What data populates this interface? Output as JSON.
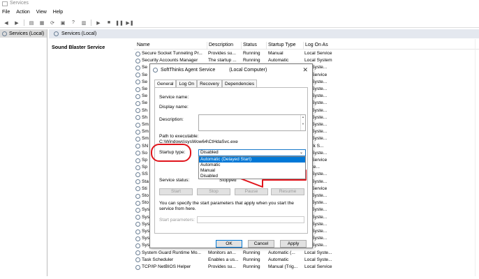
{
  "window": {
    "title": "Services"
  },
  "menu": [
    "File",
    "Action",
    "View",
    "Help"
  ],
  "sidebar": {
    "item": "Services (Local)"
  },
  "panel": {
    "tab": "Services (Local)",
    "selected_service": "Sound Blaster Service"
  },
  "table": {
    "headers": {
      "name": "Name",
      "description": "Description",
      "status": "Status",
      "startup": "Startup Type",
      "logon": "Log On As"
    },
    "rows": [
      {
        "name": "Secure Socket Tunneling Pr...",
        "description": "Provides su...",
        "status": "Running",
        "startup": "Manual",
        "logon": "Local Service"
      },
      {
        "name": "Security Accounts Manager",
        "description": "The startup ...",
        "status": "Running",
        "startup": "Automatic",
        "logon": "Local System"
      },
      {
        "name": "Se",
        "description": "",
        "status": "",
        "startup": "",
        "logon": "cal Syste..."
      },
      {
        "name": "Se",
        "description": "",
        "status": "",
        "startup": "",
        "logon": "cal Service"
      },
      {
        "name": "Se",
        "description": "",
        "status": "",
        "startup": "",
        "logon": "cal Syste..."
      },
      {
        "name": "Se",
        "description": "",
        "status": "",
        "startup": "",
        "logon": "cal Syste..."
      },
      {
        "name": "Se",
        "description": "",
        "status": "",
        "startup": "",
        "logon": "cal Syste..."
      },
      {
        "name": "Se",
        "description": "",
        "status": "",
        "startup": "",
        "logon": "cal Syste..."
      },
      {
        "name": "Sh",
        "description": "",
        "status": "",
        "startup": "",
        "logon": "cal Syste..."
      },
      {
        "name": "Sh",
        "description": "",
        "status": "",
        "startup": "",
        "logon": "cal Syste..."
      },
      {
        "name": "Sm",
        "description": "",
        "status": "",
        "startup": "",
        "logon": "cal Syste..."
      },
      {
        "name": "Sm",
        "description": "",
        "status": "",
        "startup": "",
        "logon": "cal Syste..."
      },
      {
        "name": "Sm",
        "description": "",
        "status": "",
        "startup": "",
        "logon": "cal Syste..."
      },
      {
        "name": "SN",
        "description": "",
        "status": "",
        "startup": "",
        "logon": "twork S..."
      },
      {
        "name": "So",
        "description": "",
        "status": "",
        "startup": "",
        "logon": "cal Syste..."
      },
      {
        "name": "Sp",
        "description": "",
        "status": "",
        "startup": "",
        "logon": "cal Service"
      },
      {
        "name": "Sp",
        "description": "",
        "status": "",
        "startup": "",
        "logon": "Syste..."
      },
      {
        "name": "SS",
        "description": "",
        "status": "",
        "startup": "",
        "logon": "cal Syste..."
      },
      {
        "name": "Sta",
        "description": "",
        "status": "",
        "startup": "",
        "logon": "cal Syste..."
      },
      {
        "name": "Sti",
        "description": "",
        "status": "",
        "startup": "",
        "logon": "cal Service"
      },
      {
        "name": "Sto",
        "description": "",
        "status": "",
        "startup": "",
        "logon": "cal Syste..."
      },
      {
        "name": "Sto",
        "description": "",
        "status": "",
        "startup": "",
        "logon": "cal Syste..."
      },
      {
        "name": "Sys",
        "description": "",
        "status": "",
        "startup": "",
        "logon": "cal Syste..."
      },
      {
        "name": "Sys",
        "description": "",
        "status": "",
        "startup": "",
        "logon": "cal Syste..."
      },
      {
        "name": "Sys",
        "description": "",
        "status": "",
        "startup": "",
        "logon": "cal Syste..."
      },
      {
        "name": "Sys",
        "description": "",
        "status": "",
        "startup": "",
        "logon": "cal Syste..."
      },
      {
        "name": "Sys",
        "description": "",
        "status": "",
        "startup": "",
        "logon": "cal Syste..."
      },
      {
        "name": "Sys",
        "description": "",
        "status": "",
        "startup": "",
        "logon": "cal Syste..."
      },
      {
        "name": "System Guard Runtime Mo...",
        "description": "Monitors an...",
        "status": "Running",
        "startup": "Automatic (...",
        "logon": "Local Syste..."
      },
      {
        "name": "Task Scheduler",
        "description": "Enables a us...",
        "status": "Running",
        "startup": "Automatic",
        "logon": "Local Syste..."
      },
      {
        "name": "TCP/IP NetBIOS Helper",
        "description": "Provides su...",
        "status": "Running",
        "startup": "Manual (Trig...",
        "logon": "Local Service"
      }
    ]
  },
  "dialog": {
    "title": "SoftThinks Agent Service",
    "title_suffix": "(Local Computer)",
    "close": "✕",
    "tabs": [
      "General",
      "Log On",
      "Recovery",
      "Dependencies"
    ],
    "service_name_label": "Service name:",
    "display_name_label": "Display name:",
    "description_label": "Description:",
    "path_label": "Path to executable:",
    "path_value": "C:\\Windows\\sysWow64\\CtHdaSvc.exe",
    "startup_type_label": "Startup type:",
    "startup_type_value": "Disabled",
    "options": [
      "Automatic (Delayed Start)",
      "Automatic",
      "Manual",
      "Disabled"
    ],
    "service_status_label": "Service status:",
    "service_status_value": "Stopped",
    "buttons": {
      "start": "Start",
      "stop": "Stop",
      "pause": "Pause",
      "resume": "Resume"
    },
    "help_text": "You can specify the start parameters that apply when you start the service from here.",
    "start_params_label": "Start parameters:",
    "footer": {
      "ok": "OK",
      "cancel": "Cancel",
      "apply": "Apply"
    }
  },
  "colors": {
    "highlight": "#0078d7",
    "annotation": "#e0141b"
  }
}
